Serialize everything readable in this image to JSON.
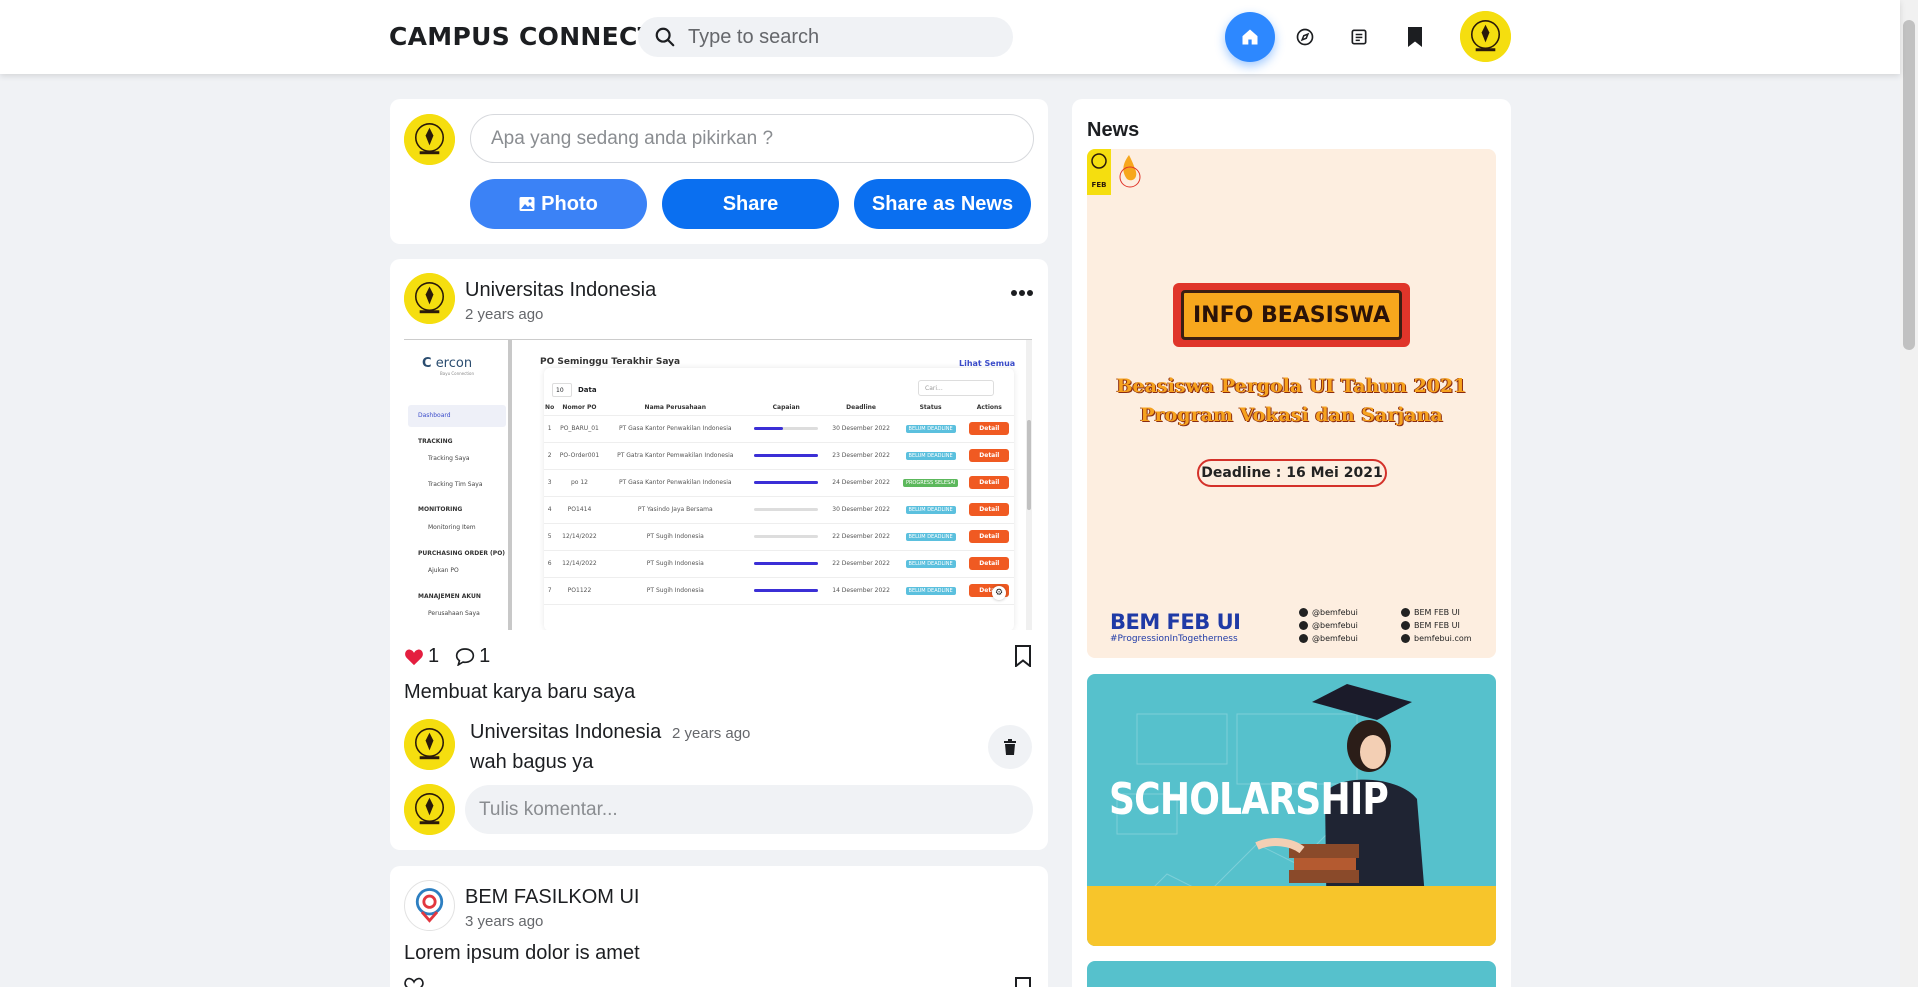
{
  "header": {
    "brand": "CAMPUS CONNECT",
    "search_placeholder": "Type to search",
    "nav": [
      "home-icon",
      "compass-icon",
      "news-icon",
      "bookmark-icon"
    ],
    "accent": "#2d88ff"
  },
  "composer": {
    "placeholder": "Apa yang sedang anda pikirkan ?",
    "photo_label": "Photo",
    "share_label": "Share",
    "share_news_label": "Share as News"
  },
  "post": {
    "author": "Universitas Indonesia",
    "time": "2 years ago",
    "likes": "1",
    "comments": "1",
    "caption": "Membuat karya baru saya",
    "screenshot": {
      "logo": "ercon",
      "logo_sub": "Bayu Connection",
      "sidebar": {
        "dashboard": "Dashboard",
        "tracking_head": "TRACKING",
        "tracking_saya": "Tracking Saya",
        "tracking_tim": "Tracking Tim Saya",
        "monitoring_head": "MONITORING",
        "monitoring_item": "Monitoring Item",
        "po_head": "PURCHASING ORDER (PO)",
        "ajukan_po": "Ajukan PO",
        "akun_head": "MANAJEMEN AKUN",
        "perusahaan": "Perusahaan Saya"
      },
      "panel_title": "PO Seminggu Terakhir Saya",
      "see_all": "Lihat Semua",
      "page_size": "10",
      "page_size_label": "Data",
      "search_placeholder": "Cari...",
      "columns": [
        "No",
        "Nomor PO",
        "Nama Perusahaan",
        "Capaian",
        "Deadline",
        "Status",
        "Actions"
      ],
      "rows": [
        {
          "no": "1",
          "po": "PO_BARU_01",
          "company": "PT Gasa Kantor Penwakilan Indonesia",
          "progress": 0.45,
          "deadline": "30 Desember 2022",
          "status": "BELUM DEADLINE",
          "action": "Detail"
        },
        {
          "no": "2",
          "po": "PO-Order001",
          "company": "PT Gatra Kantor Pemwakilan Indonesia",
          "progress": 1.0,
          "deadline": "23 Desember 2022",
          "status": "BELUM DEADLINE",
          "action": "Detail"
        },
        {
          "no": "3",
          "po": "po 12",
          "company": "PT Gasa Kantor Penwakilan Indonesia",
          "progress": 1.0,
          "deadline": "24 Desember 2022",
          "status": "PROGRESS SELESAI",
          "action": "Detail"
        },
        {
          "no": "4",
          "po": "PO1414",
          "company": "PT Yasindo Jaya Bersama",
          "progress": 0.0,
          "deadline": "30 Desember 2022",
          "status": "BELUM DEADLINE",
          "action": "Detail"
        },
        {
          "no": "5",
          "po": "12/14/2022",
          "company": "PT Sugih Indonesia",
          "progress": 0.0,
          "deadline": "22 Desember 2022",
          "status": "BELUM DEADLINE",
          "action": "Detail"
        },
        {
          "no": "6",
          "po": "12/14/2022",
          "company": "PT Sugih Indonesia",
          "progress": 1.0,
          "deadline": "22 Desember 2022",
          "status": "BELUM DEADLINE",
          "action": "Detail"
        },
        {
          "no": "7",
          "po": "PO1122",
          "company": "PT Sugih Indonesia",
          "progress": 1.0,
          "deadline": "14 Desember 2022",
          "status": "BELUM DEADLINE",
          "action": "Detail"
        }
      ]
    },
    "comment": {
      "author": "Universitas Indonesia",
      "time": "2 years ago",
      "text": "wah bagus ya"
    },
    "comment_placeholder": "Tulis komentar..."
  },
  "post2": {
    "author": "BEM FASILKOM UI",
    "time": "3 years ago",
    "caption": "Lorem ipsum dolor is amet"
  },
  "news": {
    "title": "News",
    "banner1": {
      "feb_label": "FEB",
      "headline": "INFO BEASISWA",
      "line1": "Beasiswa Pergola UI Tahun 2021",
      "line2": "Program Vokasi dan Sarjana",
      "deadline": "Deadline : 16 Mei 2021",
      "org": "BEM FEB UI",
      "tagline": "#ProgressionInTogetherness",
      "social": [
        "@bemfebui",
        "@bemfebui",
        "@bemfebui",
        "BEM FEB UI",
        "BEM FEB UI",
        "bemfebui.com"
      ]
    },
    "banner2": {
      "headline": "SCHOLARSHIP"
    }
  }
}
